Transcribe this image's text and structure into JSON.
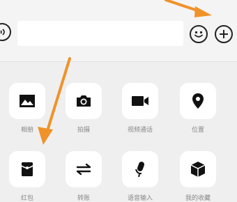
{
  "input_bar": {
    "message_value": "",
    "voice_icon": "voice-icon",
    "emoji_icon": "emoji-icon",
    "plus_icon": "plus-icon"
  },
  "panel": {
    "row1": [
      {
        "label": "相册",
        "icon": "photo-icon"
      },
      {
        "label": "拍摄",
        "icon": "camera-icon"
      },
      {
        "label": "视频通话",
        "icon": "video-call-icon"
      },
      {
        "label": "位置",
        "icon": "location-icon"
      }
    ],
    "row2": [
      {
        "label": "红包",
        "icon": "red-packet-icon"
      },
      {
        "label": "转账",
        "icon": "transfer-icon"
      },
      {
        "label": "语音输入",
        "icon": "voice-input-icon"
      },
      {
        "label": "我的收藏",
        "icon": "favorites-icon"
      }
    ]
  },
  "colors": {
    "annotation_arrow": "#f0922a",
    "icon": "#111111",
    "tile_background": "#ffffff",
    "panel_background": "#efefef"
  }
}
